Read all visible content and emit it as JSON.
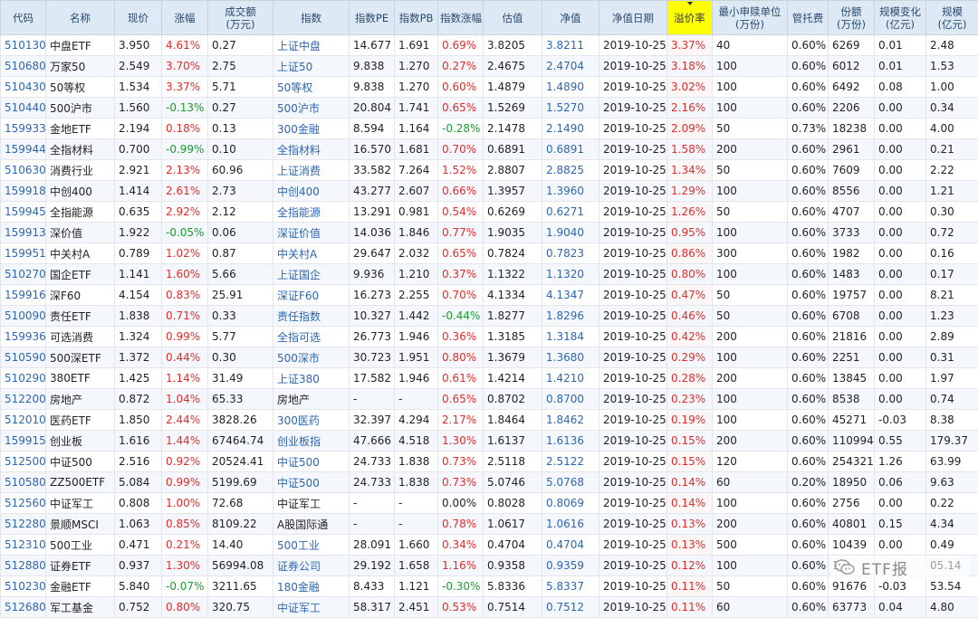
{
  "headers": [
    "代码",
    "名称",
    "现价",
    "涨幅",
    "成交额\n(万元)",
    "指数",
    "指数PE",
    "指数PB",
    "指数涨幅",
    "估值",
    "净值",
    "净值日期",
    "溢价率",
    "最小申赎单位\n(万份)",
    "管托费",
    "份额\n(万份)",
    "规模变化\n(亿元)",
    "规模\n(亿元)"
  ],
  "rows": [
    [
      "510130",
      "中盘ETF",
      "3.950",
      "4.61%",
      "0.27",
      "上证中盘",
      "14.677",
      "1.691",
      "0.69%",
      "3.8205",
      "3.8211",
      "2019-10-25",
      "3.37%",
      "40",
      "0.60%",
      "6269",
      "0.01",
      "2.48"
    ],
    [
      "510680",
      "万家50",
      "2.549",
      "3.70%",
      "2.75",
      "上证50",
      "9.838",
      "1.270",
      "0.27%",
      "2.4675",
      "2.4704",
      "2019-10-25",
      "3.18%",
      "100",
      "0.60%",
      "6012",
      "0.01",
      "1.53"
    ],
    [
      "510430",
      "50等权",
      "1.534",
      "3.37%",
      "5.71",
      "50等权",
      "9.838",
      "1.270",
      "0.60%",
      "1.4879",
      "1.4890",
      "2019-10-25",
      "3.02%",
      "100",
      "0.60%",
      "6492",
      "0.08",
      "1.00"
    ],
    [
      "510440",
      "500沪市",
      "1.560",
      "-0.13%",
      "0.27",
      "500沪市",
      "20.804",
      "1.741",
      "0.65%",
      "1.5269",
      "1.5270",
      "2019-10-25",
      "2.16%",
      "100",
      "0.60%",
      "2206",
      "0.00",
      "0.34"
    ],
    [
      "159933",
      "金地ETF",
      "2.194",
      "0.18%",
      "0.13",
      "300金融",
      "8.594",
      "1.164",
      "-0.28%",
      "2.1478",
      "2.1490",
      "2019-10-25",
      "2.09%",
      "50",
      "0.73%",
      "18238",
      "0.00",
      "4.00"
    ],
    [
      "159944",
      "全指材料",
      "0.700",
      "-0.99%",
      "0.10",
      "全指材料",
      "16.570",
      "1.681",
      "0.70%",
      "0.6891",
      "0.6891",
      "2019-10-25",
      "1.58%",
      "200",
      "0.60%",
      "2961",
      "0.00",
      "0.21"
    ],
    [
      "510630",
      "消费行业",
      "2.921",
      "2.13%",
      "60.96",
      "上证消费",
      "33.582",
      "7.264",
      "1.52%",
      "2.8807",
      "2.8825",
      "2019-10-25",
      "1.34%",
      "50",
      "0.60%",
      "7609",
      "0.00",
      "2.22"
    ],
    [
      "159918",
      "中创400",
      "1.414",
      "2.61%",
      "2.73",
      "中创400",
      "43.277",
      "2.607",
      "0.66%",
      "1.3957",
      "1.3960",
      "2019-10-25",
      "1.29%",
      "100",
      "0.60%",
      "8556",
      "0.00",
      "1.21"
    ],
    [
      "159945",
      "全指能源",
      "0.635",
      "2.92%",
      "2.12",
      "全指能源",
      "13.291",
      "0.981",
      "0.54%",
      "0.6269",
      "0.6271",
      "2019-10-25",
      "1.26%",
      "50",
      "0.60%",
      "4707",
      "0.00",
      "0.30"
    ],
    [
      "159913",
      "深价值",
      "1.922",
      "-0.05%",
      "0.06",
      "深证价值",
      "14.036",
      "1.846",
      "0.77%",
      "1.9035",
      "1.9040",
      "2019-10-25",
      "0.95%",
      "100",
      "0.60%",
      "3733",
      "0.00",
      "0.72"
    ],
    [
      "159951",
      "中关村A",
      "0.789",
      "1.02%",
      "0.87",
      "中关村A",
      "29.647",
      "2.032",
      "0.65%",
      "0.7824",
      "0.7823",
      "2019-10-25",
      "0.86%",
      "300",
      "0.60%",
      "1982",
      "0.00",
      "0.16"
    ],
    [
      "510270",
      "国企ETF",
      "1.141",
      "1.60%",
      "5.66",
      "上证国企",
      "9.936",
      "1.210",
      "0.37%",
      "1.1322",
      "1.1320",
      "2019-10-25",
      "0.80%",
      "100",
      "0.60%",
      "1483",
      "0.00",
      "0.17"
    ],
    [
      "159916",
      "深F60",
      "4.154",
      "0.83%",
      "25.91",
      "深证F60",
      "16.273",
      "2.255",
      "0.70%",
      "4.1334",
      "4.1347",
      "2019-10-25",
      "0.47%",
      "50",
      "0.60%",
      "19757",
      "0.00",
      "8.21"
    ],
    [
      "510090",
      "责任ETF",
      "1.838",
      "0.71%",
      "0.33",
      "责任指数",
      "10.327",
      "1.442",
      "-0.44%",
      "1.8277",
      "1.8296",
      "2019-10-25",
      "0.46%",
      "50",
      "0.60%",
      "6708",
      "0.00",
      "1.23"
    ],
    [
      "159936",
      "可选消费",
      "1.324",
      "0.99%",
      "5.77",
      "全指可选",
      "26.773",
      "1.946",
      "0.36%",
      "1.3185",
      "1.3184",
      "2019-10-25",
      "0.42%",
      "200",
      "0.60%",
      "21816",
      "0.00",
      "2.89"
    ],
    [
      "510590",
      "500深ETF",
      "1.372",
      "0.44%",
      "0.30",
      "500深市",
      "30.723",
      "1.951",
      "0.80%",
      "1.3679",
      "1.3680",
      "2019-10-25",
      "0.29%",
      "100",
      "0.60%",
      "2251",
      "0.00",
      "0.31"
    ],
    [
      "510290",
      "380ETF",
      "1.425",
      "1.14%",
      "31.49",
      "上证380",
      "17.582",
      "1.946",
      "0.61%",
      "1.4214",
      "1.4210",
      "2019-10-25",
      "0.28%",
      "200",
      "0.60%",
      "13845",
      "0.00",
      "1.97"
    ],
    [
      "512200",
      "房地产",
      "0.872",
      "1.04%",
      "65.33",
      "房地产",
      "-",
      "-",
      "0.65%",
      "0.8702",
      "0.8700",
      "2019-10-25",
      "0.23%",
      "100",
      "0.60%",
      "8538",
      "0.00",
      "0.74"
    ],
    [
      "512010",
      "医药ETF",
      "1.850",
      "2.44%",
      "3828.26",
      "300医药",
      "32.397",
      "4.294",
      "2.17%",
      "1.8464",
      "1.8462",
      "2019-10-25",
      "0.19%",
      "100",
      "0.60%",
      "45271",
      "-0.03",
      "8.38"
    ],
    [
      "159915",
      "创业板",
      "1.616",
      "1.44%",
      "67464.74",
      "创业板指",
      "47.666",
      "4.518",
      "1.30%",
      "1.6137",
      "1.6136",
      "2019-10-25",
      "0.15%",
      "200",
      "0.60%",
      "1109945",
      "0.55",
      "179.37"
    ],
    [
      "512500",
      "中证500",
      "2.516",
      "0.92%",
      "20524.41",
      "中证500",
      "24.733",
      "1.838",
      "0.73%",
      "2.5118",
      "2.5122",
      "2019-10-25",
      "0.15%",
      "120",
      "0.60%",
      "254321",
      "1.26",
      "63.99"
    ],
    [
      "510580",
      "ZZ500ETF",
      "5.084",
      "0.99%",
      "5199.69",
      "中证500",
      "24.733",
      "1.838",
      "0.73%",
      "5.0746",
      "5.0768",
      "2019-10-25",
      "0.14%",
      "60",
      "0.20%",
      "18950",
      "0.06",
      "9.63"
    ],
    [
      "512560",
      "中证军工",
      "0.808",
      "1.00%",
      "72.68",
      "中证军工",
      "-",
      "-",
      "0.00%",
      "0.8028",
      "0.8069",
      "2019-10-25",
      "0.14%",
      "100",
      "0.60%",
      "2756",
      "0.00",
      "0.22"
    ],
    [
      "512280",
      "景顺MSCI",
      "1.063",
      "0.85%",
      "8109.22",
      "A股国际通",
      "-",
      "-",
      "0.78%",
      "1.0617",
      "1.0616",
      "2019-10-25",
      "0.13%",
      "200",
      "0.60%",
      "40801",
      "0.15",
      "4.34"
    ],
    [
      "512310",
      "500工业",
      "0.471",
      "0.21%",
      "14.40",
      "500工业",
      "28.091",
      "1.660",
      "0.34%",
      "0.4704",
      "0.4704",
      "2019-10-25",
      "0.13%",
      "500",
      "0.60%",
      "10439",
      "0.00",
      "0.49"
    ],
    [
      "512880",
      "证券ETF",
      "0.937",
      "1.30%",
      "56994.08",
      "证券公司",
      "29.192",
      "1.658",
      "1.16%",
      "0.9358",
      "0.9359",
      "2019-10-25",
      "0.12%",
      "100",
      "0.60%",
      "1",
      "",
      "05.14"
    ],
    [
      "510230",
      "金融ETF",
      "5.840",
      "-0.07%",
      "3211.65",
      "180金融",
      "8.433",
      "1.121",
      "-0.30%",
      "5.8336",
      "5.8337",
      "2019-10-25",
      "0.11%",
      "50",
      "0.60%",
      "91676",
      "-0.03",
      "53.54"
    ],
    [
      "512680",
      "军工基金",
      "0.752",
      "0.80%",
      "320.75",
      "中证军工",
      "58.317",
      "2.451",
      "0.53%",
      "0.7514",
      "0.7512",
      "2019-10-25",
      "0.11%",
      "60",
      "0.60%",
      "63773",
      "0.04",
      "4.80"
    ]
  ],
  "watermark": {
    "text": "ETF报",
    "icon": "wechat-icon"
  }
}
